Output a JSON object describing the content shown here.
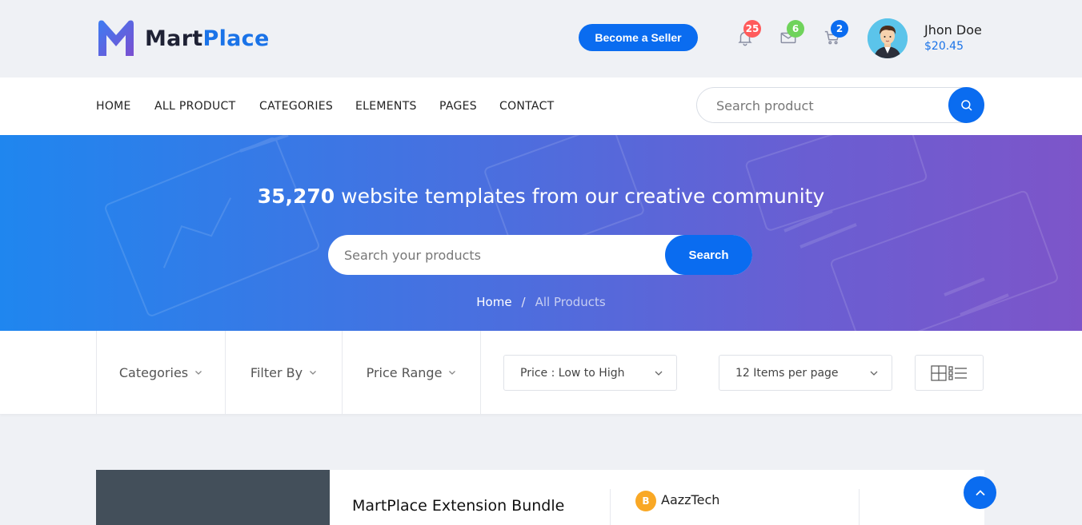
{
  "brand": {
    "name_part1": "Mart",
    "name_part2": "Place",
    "colors": {
      "primary": "#0a6cf0",
      "dark": "#1f2235"
    }
  },
  "header": {
    "seller_button": "Become a Seller",
    "notifications": {
      "icon": "bell-icon",
      "count": "25"
    },
    "messages": {
      "icon": "envelope-icon",
      "count": "6"
    },
    "cart": {
      "icon": "cart-icon",
      "count": "2"
    },
    "user": {
      "name": "Jhon Doe",
      "balance": "$20.45"
    }
  },
  "nav": {
    "items": [
      "HOME",
      "ALL PRODUCT",
      "CATEGORIES",
      "ELEMENTS",
      "PAGES",
      "CONTACT"
    ],
    "search_placeholder": "Search product"
  },
  "hero": {
    "count": "35,270",
    "title_rest": " website templates from our creative community",
    "search_placeholder": "Search your products",
    "search_button": "Search",
    "breadcrumb": {
      "home": "Home",
      "separator": "/",
      "current": "All Products"
    }
  },
  "filters": {
    "categories": "Categories",
    "filter_by": "Filter By",
    "price_range": "Price Range",
    "sort_selected": "Price : Low to High",
    "per_page_selected": "12 Items per page"
  },
  "product": {
    "title": "MartPlace Extension Bundle",
    "author_initial": "B",
    "author": "AazzTech"
  }
}
